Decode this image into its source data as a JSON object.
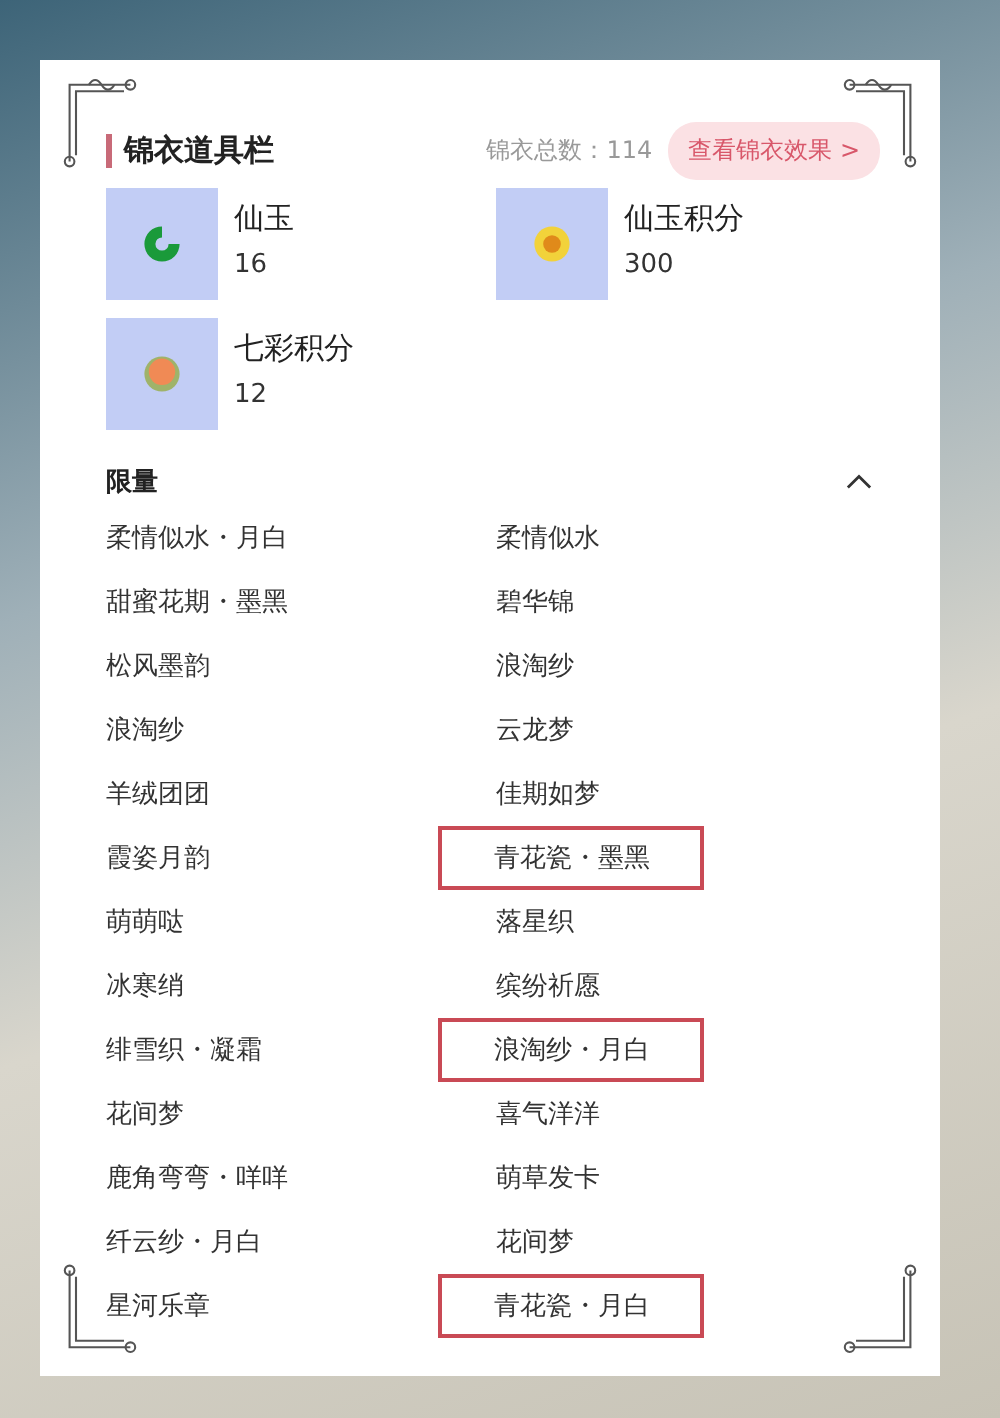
{
  "header": {
    "title": "锦衣道具栏",
    "total": "锦衣总数：114",
    "effect_button": "查看锦衣效果 >"
  },
  "items": [
    {
      "name": "仙玉",
      "count": "16",
      "kind": "jade"
    },
    {
      "name": "仙玉积分",
      "count": "300",
      "kind": "coin"
    },
    {
      "name": "七彩积分",
      "count": "12",
      "kind": "orb"
    }
  ],
  "section": {
    "title": "限量",
    "expanded": true,
    "entries": [
      {
        "name": "柔情似水・月白",
        "highlighted": false
      },
      {
        "name": "柔情似水",
        "highlighted": false
      },
      {
        "name": "甜蜜花期・墨黑",
        "highlighted": false
      },
      {
        "name": "碧华锦",
        "highlighted": false
      },
      {
        "name": "松风墨韵",
        "highlighted": false
      },
      {
        "name": "浪淘纱",
        "highlighted": false
      },
      {
        "name": "浪淘纱",
        "highlighted": false
      },
      {
        "name": "云龙梦",
        "highlighted": false
      },
      {
        "name": "羊绒团团",
        "highlighted": false
      },
      {
        "name": "佳期如梦",
        "highlighted": false
      },
      {
        "name": "霞姿月韵",
        "highlighted": false
      },
      {
        "name": "青花瓷・墨黑",
        "highlighted": true
      },
      {
        "name": "萌萌哒",
        "highlighted": false
      },
      {
        "name": "落星织",
        "highlighted": false
      },
      {
        "name": "冰寒绡",
        "highlighted": false
      },
      {
        "name": "缤纷祈愿",
        "highlighted": false
      },
      {
        "name": "绯雪织・凝霜",
        "highlighted": false
      },
      {
        "name": "浪淘纱・月白",
        "highlighted": true
      },
      {
        "name": "花间梦",
        "highlighted": false
      },
      {
        "name": "喜气洋洋",
        "highlighted": false
      },
      {
        "name": "鹿角弯弯・咩咩",
        "highlighted": false
      },
      {
        "name": "萌草发卡",
        "highlighted": false
      },
      {
        "name": "纤云纱・月白",
        "highlighted": false
      },
      {
        "name": "花间梦",
        "highlighted": false
      },
      {
        "name": "星河乐章",
        "highlighted": false
      },
      {
        "name": "青花瓷・月白",
        "highlighted": true
      }
    ]
  }
}
